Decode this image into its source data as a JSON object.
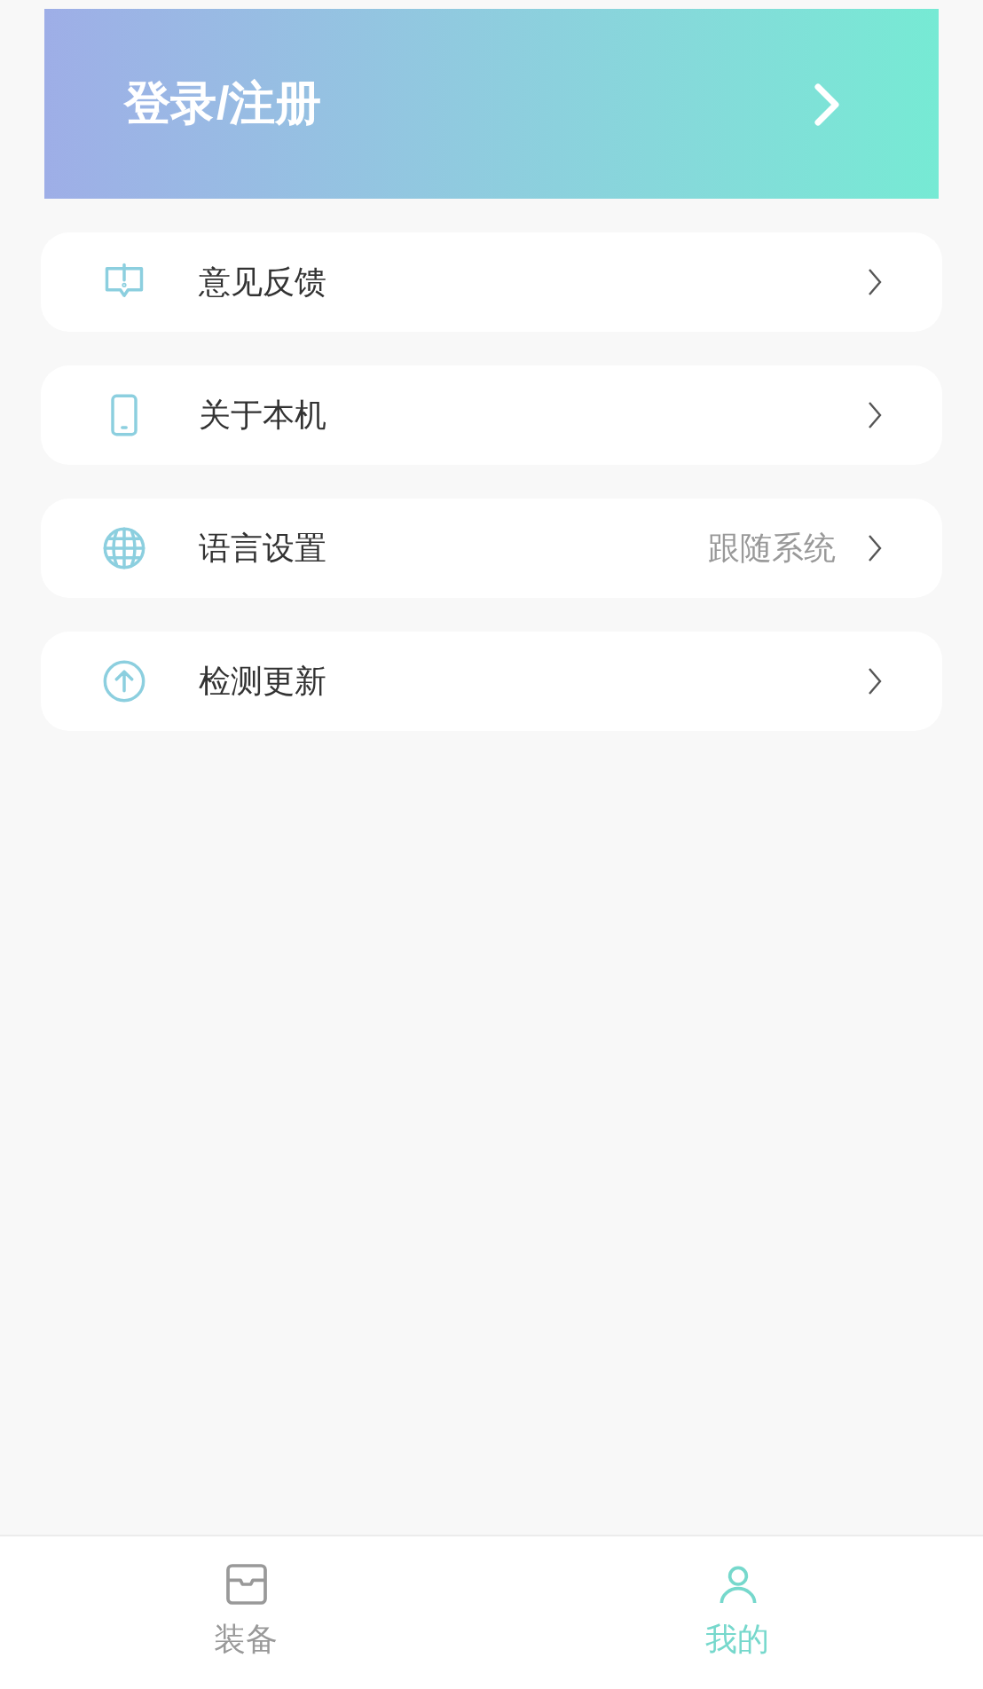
{
  "header": {
    "title": "登录/注册"
  },
  "menu": [
    {
      "kind": "feedback",
      "label": "意见反馈"
    },
    {
      "kind": "device",
      "label": "关于本机"
    },
    {
      "kind": "language",
      "label": "语言设置",
      "value": "跟随系统"
    },
    {
      "kind": "update",
      "label": "检测更新"
    }
  ],
  "tabs": [
    {
      "kind": "gear",
      "label": "装备",
      "selected": false
    },
    {
      "kind": "profile",
      "label": "我的",
      "selected": true
    }
  ]
}
